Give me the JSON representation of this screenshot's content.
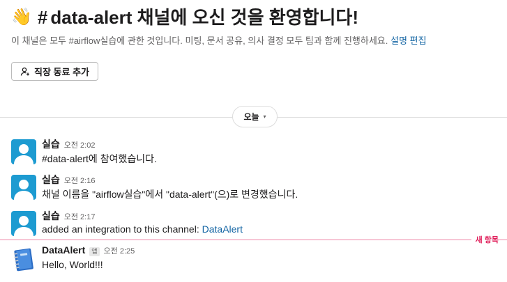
{
  "intro": {
    "wave_emoji": "👋",
    "hash": "#",
    "channel_name": "data-alert",
    "title_suffix": " 채널에 오신 것을 환영합니다!",
    "description": "이 채널은 모두 #airflow실습에 관한 것입니다. 미팅, 문서 공유, 의사 결정 모두 팀과 함께 진행하세요.",
    "link_describe": "설명",
    "link_edit": "편집"
  },
  "add_coworker": {
    "icon": "add-user-icon",
    "label": "직장 동료 추가"
  },
  "day_divider": {
    "label": "오늘",
    "chevron": "⌄"
  },
  "messages": [
    {
      "sender": "실습",
      "time": "오전 2:02",
      "text": "#data-alert에 참여했습니다."
    },
    {
      "sender": "실습",
      "time": "오전 2:16",
      "text": "채널 이름을 \"airflow실습\"에서 \"data-alert\"(으)로 변경했습니다."
    },
    {
      "sender": "실습",
      "time": "오전 2:17",
      "text_prefix": "added an integration to this channel: ",
      "link": "DataAlert"
    },
    {
      "sender": "DataAlert",
      "badge": "앱",
      "time": "오전 2:25",
      "text": "Hello, World!!!"
    }
  ],
  "new_items": {
    "label": "새 항목"
  },
  "colors": {
    "link": "#1264a3",
    "new_marker": "#e01e5a",
    "avatar_bg": "#1d9bd1"
  }
}
